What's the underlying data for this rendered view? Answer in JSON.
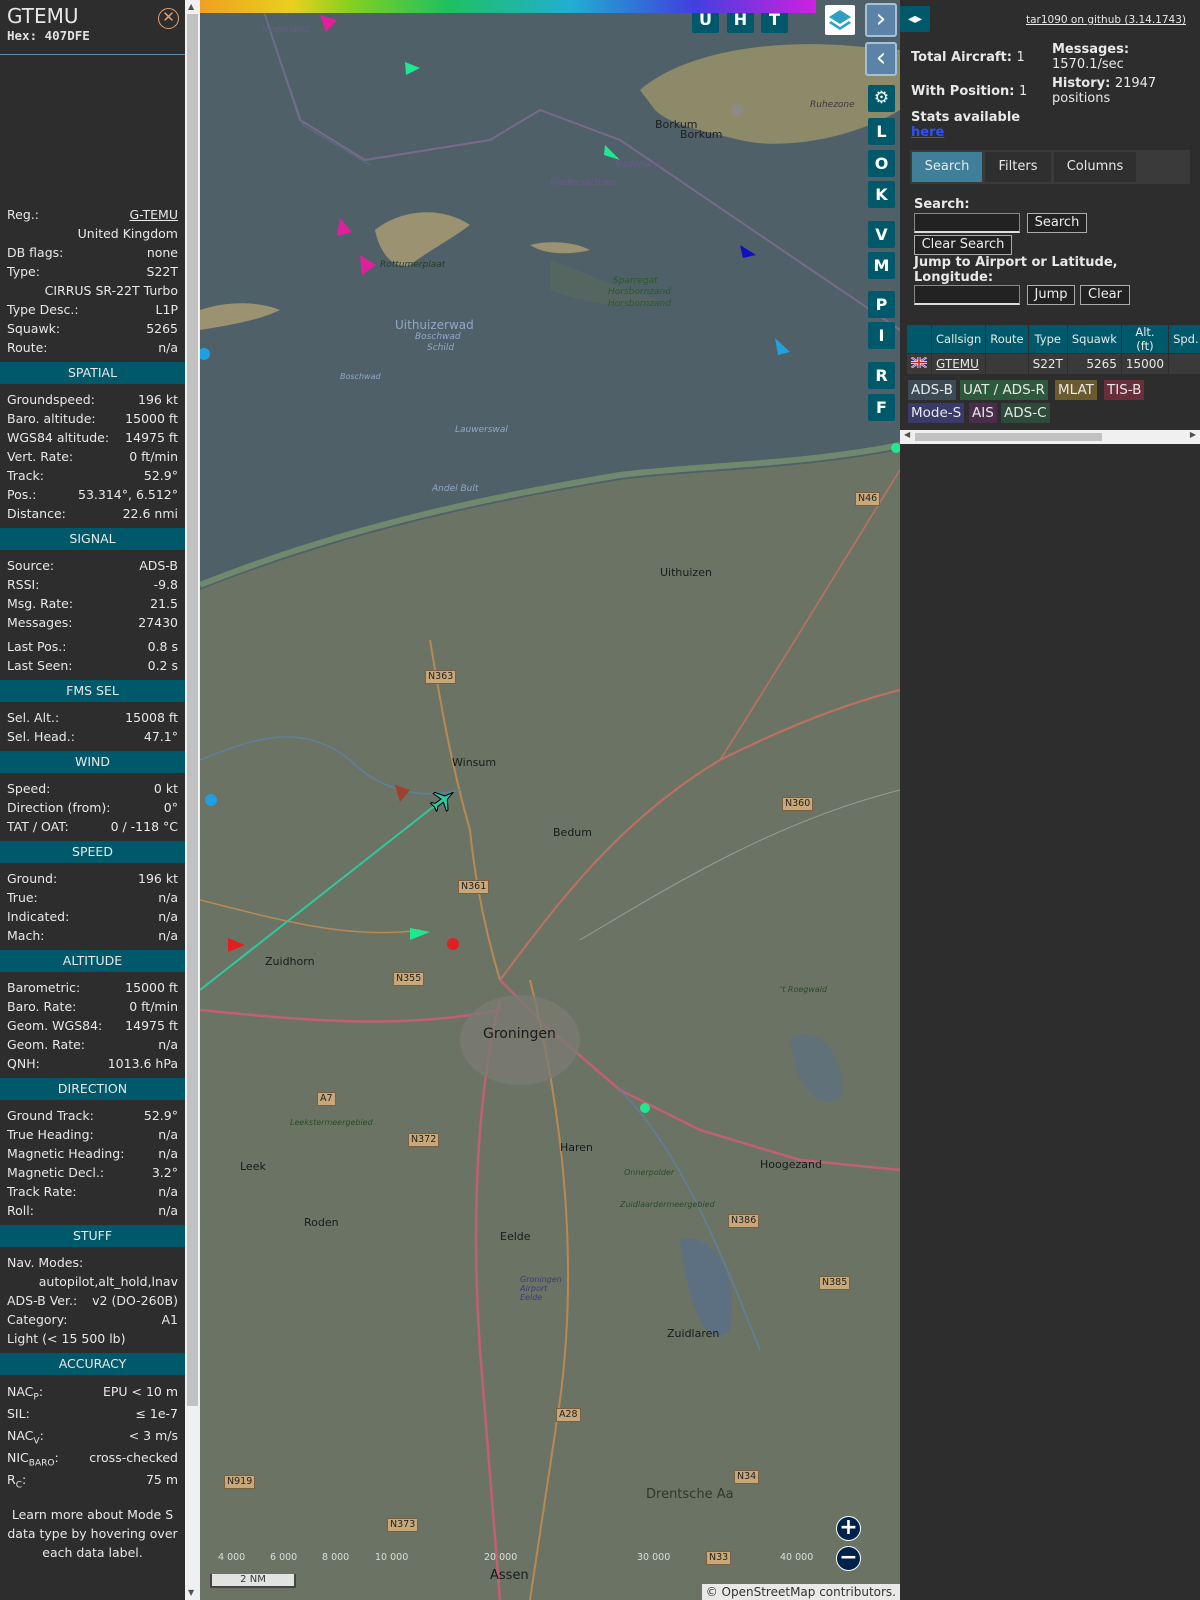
{
  "selected": {
    "callsign": "GTEMU",
    "hex_label": "Hex: 407DFE",
    "top": [
      {
        "k": "Reg.:",
        "v": "G-TEMU",
        "link": true
      },
      {
        "k": "",
        "v": "United Kingdom"
      },
      {
        "k": "DB flags:",
        "v": "none"
      },
      {
        "k": "Type:",
        "v": "S22T"
      },
      {
        "k": "",
        "v": "CIRRUS SR-22T Turbo"
      },
      {
        "k": "Type Desc.:",
        "v": "L1P"
      },
      {
        "k": "Squawk:",
        "v": "5265"
      },
      {
        "k": "Route:",
        "v": "n/a"
      }
    ],
    "sections": [
      {
        "title": "SPATIAL",
        "rows": [
          {
            "k": "Groundspeed:",
            "v": "196 kt"
          },
          {
            "k": "Baro. altitude:",
            "v": "15000 ft"
          },
          {
            "k": "WGS84 altitude:",
            "v": "14975 ft"
          },
          {
            "k": "Vert. Rate:",
            "v": "0 ft/min"
          },
          {
            "k": "Track:",
            "v": "52.9°"
          },
          {
            "k": "Pos.:",
            "v": "53.314°, 6.512°"
          },
          {
            "k": "Distance:",
            "v": "22.6 nmi"
          }
        ]
      },
      {
        "title": "SIGNAL",
        "rows": [
          {
            "k": "Source:",
            "v": "ADS-B"
          },
          {
            "k": "RSSI:",
            "v": "-9.8"
          },
          {
            "k": "Msg. Rate:",
            "v": "21.5"
          },
          {
            "k": "Messages:",
            "v": "27430"
          },
          {
            "k": "Last Pos.:",
            "v": "0.8 s",
            "gap": true
          },
          {
            "k": "Last Seen:",
            "v": "0.2 s"
          }
        ]
      },
      {
        "title": "FMS SEL",
        "rows": [
          {
            "k": "Sel. Alt.:",
            "v": "15008 ft"
          },
          {
            "k": "Sel. Head.:",
            "v": "47.1°"
          }
        ]
      },
      {
        "title": "WIND",
        "rows": [
          {
            "k": "Speed:",
            "v": "0 kt"
          },
          {
            "k": "Direction (from):",
            "v": "0°"
          },
          {
            "k": "TAT / OAT:",
            "v": "0 / -118 °C"
          }
        ]
      },
      {
        "title": "SPEED",
        "rows": [
          {
            "k": "Ground:",
            "v": "196 kt"
          },
          {
            "k": "True:",
            "v": "n/a"
          },
          {
            "k": "Indicated:",
            "v": "n/a"
          },
          {
            "k": "Mach:",
            "v": "n/a"
          }
        ]
      },
      {
        "title": "ALTITUDE",
        "rows": [
          {
            "k": "Barometric:",
            "v": "15000 ft"
          },
          {
            "k": "Baro. Rate:",
            "v": "0 ft/min"
          },
          {
            "k": "Geom. WGS84:",
            "v": "14975 ft"
          },
          {
            "k": "Geom. Rate:",
            "v": "n/a"
          },
          {
            "k": "QNH:",
            "v": "1013.6 hPa"
          }
        ]
      },
      {
        "title": "DIRECTION",
        "rows": [
          {
            "k": "Ground Track:",
            "v": "52.9°"
          },
          {
            "k": "True Heading:",
            "v": "n/a"
          },
          {
            "k": "Magnetic Heading:",
            "v": "n/a"
          },
          {
            "k": "Magnetic Decl.:",
            "v": "3.2°"
          },
          {
            "k": "Track Rate:",
            "v": "n/a"
          },
          {
            "k": "Roll:",
            "v": "n/a"
          }
        ]
      },
      {
        "title": "STUFF",
        "rows": [
          {
            "k": "Nav. Modes:",
            "v": ""
          },
          {
            "k": "",
            "v": "autopilot,alt_hold,lnav"
          },
          {
            "k": "ADS-B Ver.:",
            "v": "v2 (DO-260B)"
          },
          {
            "k": "Category:",
            "v": "A1"
          },
          {
            "k": "Light (< 15 500 lb)",
            "v": ""
          }
        ]
      }
    ],
    "accuracy": {
      "title": "ACCURACY",
      "nacp_k": "NAC",
      "nacp_sub": "P",
      "nacp_v": "EPU < 10 m",
      "sil_k": "SIL:",
      "sil_v": "≤ 1e-7",
      "nacv_k": "NAC",
      "nacv_sub": "V",
      "nacv_v": "< 3 m/s",
      "nicbaro_k": "NIC",
      "nicbaro_sub": "BARO",
      "nicbaro_v": "cross-checked",
      "rc_k": "R",
      "rc_sub": "C",
      "rc_v": "75 m"
    },
    "learn_more": "Learn more about Mode S data type by hovering over each data label."
  },
  "map": {
    "places": [
      {
        "name": "Borkum"
      },
      {
        "name": "Borkum"
      },
      {
        "name": "Rottumerplaat"
      },
      {
        "name": "Uithuizerwad"
      },
      {
        "name": "Boschwad"
      },
      {
        "name": "Schild"
      },
      {
        "name": "Sparregat"
      },
      {
        "name": "Horsbornzand"
      },
      {
        "name": "Horsbornzand"
      },
      {
        "name": "Lauwerswal"
      },
      {
        "name": "Andel Bult"
      },
      {
        "name": "Uithuizen"
      },
      {
        "name": "Winsum"
      },
      {
        "name": "Bedum"
      },
      {
        "name": "Zuidhorn"
      },
      {
        "name": "Groningen"
      },
      {
        "name": "Haren"
      },
      {
        "name": "Hoogezand"
      },
      {
        "name": "Leek"
      },
      {
        "name": "Roden"
      },
      {
        "name": "Eelde"
      },
      {
        "name": "Groningen Airport Eelde"
      },
      {
        "name": "Zuidlaren"
      },
      {
        "name": "Drentsche Aa"
      },
      {
        "name": "Assen"
      },
      {
        "name": "Leekstermeergebied"
      },
      {
        "name": "Onnerpolder"
      },
      {
        "name": "Zuidlaardermeergebied"
      },
      {
        "name": "'t Roegwald"
      },
      {
        "name": "Niedersachsen"
      },
      {
        "name": "Nederland"
      },
      {
        "name": "Nederland"
      },
      {
        "name": "Ruhezone"
      },
      {
        "name": "Boschwad"
      }
    ],
    "roads": [
      "N46",
      "N363",
      "N360",
      "N361",
      "N355",
      "N372",
      "A7",
      "N386",
      "N385",
      "A28",
      "N34",
      "N919",
      "N373",
      "N33"
    ],
    "buttons": [
      "U",
      "H",
      "T",
      "L",
      "O",
      "K",
      "V",
      "M",
      "P",
      "I",
      "R",
      "F"
    ],
    "altitude_labels": [
      "4 000",
      "6 000",
      "8 000",
      "10 000",
      "20 000",
      "30 000",
      "40 000"
    ],
    "scale_label": "2 NM",
    "attribution": "© OpenStreetMap contributors."
  },
  "panel": {
    "github_link": "tar1090 on github (3.14.1743)",
    "total_label": "Total Aircraft:",
    "total_value": "1",
    "withpos_label": "With Position:",
    "withpos_value": "1",
    "stats_label": "Stats available",
    "stats_link": "here",
    "messages_label": "Messages:",
    "messages_value": "1570.1/sec",
    "history_label": "History:",
    "history_value": "21947 positions",
    "tabs": [
      "Search",
      "Filters",
      "Columns"
    ],
    "search_label": "Search:",
    "search_btn": "Search",
    "clear_search_btn": "Clear Search",
    "jump_label": "Jump to Airport or Latitude, Longitude:",
    "jump_btn": "Jump",
    "clear_btn": "Clear",
    "table_headers": [
      "",
      "Callsign",
      "Route",
      "Type",
      "Squawk",
      "Alt. (ft)",
      "Spd."
    ],
    "table_row": {
      "callsign": "GTEMU",
      "route": "",
      "type": "S22T",
      "squawk": "5265",
      "alt": "15000",
      "spd": ""
    },
    "sources": [
      {
        "label": "ADS-B",
        "bg": "#3c4a55"
      },
      {
        "label": "UAT / ADS-R",
        "bg": "#2d5a3c"
      },
      {
        "label": "MLAT",
        "bg": "#6a5a2d"
      },
      {
        "label": "TIS-B",
        "bg": "#6a2d3a"
      },
      {
        "label": "Mode-S",
        "bg": "#3a3a6a"
      },
      {
        "label": "AIS",
        "bg": "#4a2d4a"
      },
      {
        "label": "ADS-C",
        "bg": "#2d4a3a"
      }
    ]
  }
}
